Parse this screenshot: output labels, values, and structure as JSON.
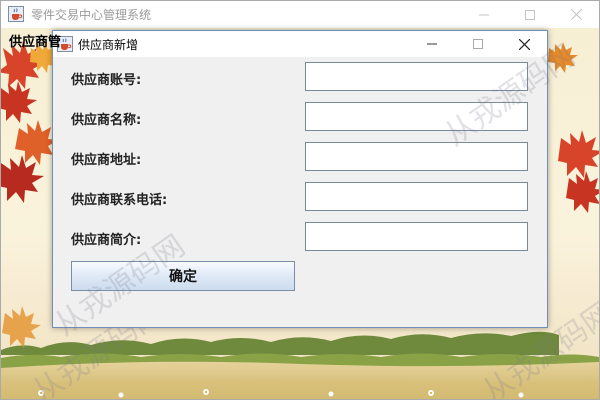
{
  "main_window": {
    "title": "零件交易中心管理系统",
    "header_label": "供应商管"
  },
  "dialog": {
    "title": "供应商新增",
    "fields": [
      {
        "label": "供应商账号:",
        "value": ""
      },
      {
        "label": "供应商名称:",
        "value": ""
      },
      {
        "label": "供应商地址:",
        "value": ""
      },
      {
        "label": "供应商联系电话:",
        "value": ""
      },
      {
        "label": "供应商简介:",
        "value": ""
      }
    ],
    "confirm_label": "确定"
  },
  "watermarks": [
    "从戎源码网",
    "从戎源码网",
    "从戎源码网",
    "从戎源码网"
  ],
  "icons": {
    "app": "java-cup-icon",
    "minimize": "minimize-icon",
    "maximize": "maximize-icon",
    "close": "close-icon"
  }
}
